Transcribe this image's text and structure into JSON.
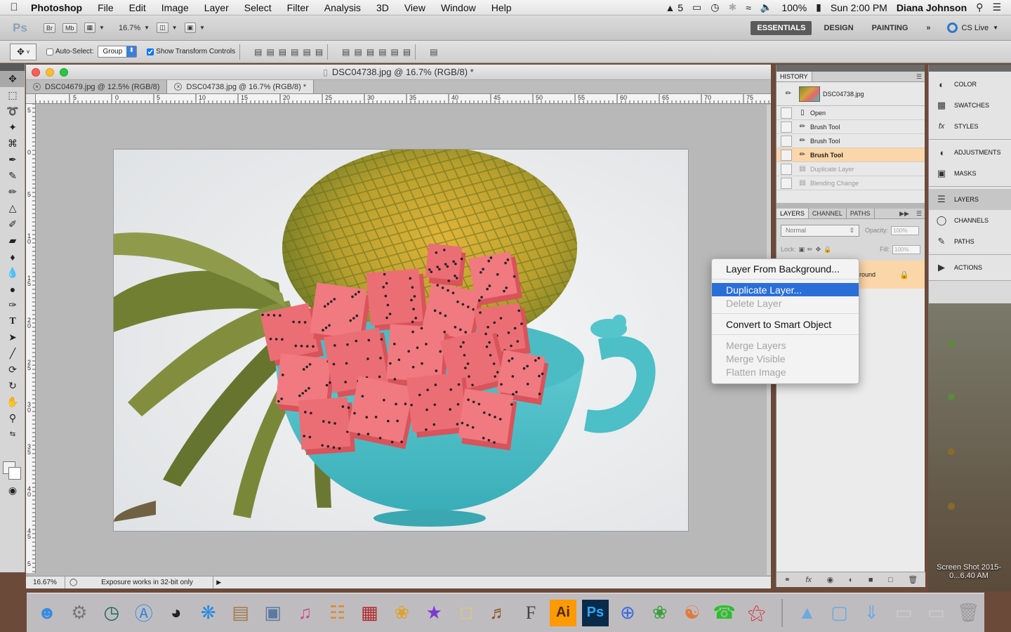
{
  "menubar": {
    "app_name": "Photoshop",
    "items": [
      "File",
      "Edit",
      "Image",
      "Layer",
      "Select",
      "Filter",
      "Analysis",
      "3D",
      "View",
      "Window",
      "Help"
    ],
    "status": {
      "adobe_badge": "5",
      "battery": "100%",
      "clock": "Sun 2:00 PM",
      "user": "Diana Johnson"
    }
  },
  "appbar": {
    "logo": "Ps",
    "bridge_label": "Br",
    "minibridge_label": "Mb",
    "zoom": "16.7%",
    "workspaces": [
      "ESSENTIALS",
      "DESIGN",
      "PAINTING"
    ],
    "cs_live": "CS Live"
  },
  "options": {
    "auto_select_label": "Auto-Select:",
    "auto_select_checked": false,
    "group_value": "Group",
    "show_transform_label": "Show Transform Controls",
    "show_transform_checked": true
  },
  "document": {
    "title": "DSC04738.jpg @ 16.7% (RGB/8) *",
    "tabs": [
      {
        "label": "DSC04679.jpg @ 12.5% (RGB/8)",
        "active": false
      },
      {
        "label": "DSC04738.jpg @ 16.7% (RGB/8) *",
        "active": true
      }
    ],
    "ruler_h": [
      "5",
      "0",
      "5",
      "10",
      "15",
      "20",
      "25",
      "30",
      "35",
      "40",
      "45",
      "50",
      "55",
      "60",
      "65",
      "70",
      "75"
    ],
    "ruler_v": [
      "5",
      "0",
      "5",
      "1\n0",
      "1\n5",
      "2\n0",
      "2\n5",
      "3\n0",
      "3\n5",
      "4\n0",
      "4\n5",
      "5"
    ],
    "status_zoom": "16.67%",
    "status_info": "Exposure works in 32-bit only"
  },
  "history": {
    "tab": "HISTORY",
    "snapshot": "DSC04738.jpg",
    "steps": [
      {
        "label": "Open",
        "state": "normal"
      },
      {
        "label": "Brush Tool",
        "state": "normal"
      },
      {
        "label": "Brush Tool",
        "state": "normal"
      },
      {
        "label": "Brush Tool",
        "state": "current"
      },
      {
        "label": "Duplicate Layer",
        "state": "dim"
      },
      {
        "label": "Blending Change",
        "state": "dim"
      }
    ]
  },
  "layers": {
    "tabs": [
      "LAYERS",
      "CHANNEL",
      "PATHS"
    ],
    "blend_mode": "Normal",
    "opacity_label": "Opacity:",
    "opacity_value": "100%",
    "lock_label": "Lock:",
    "fill_label": "Fill:",
    "fill_value": "100%",
    "layer_name_fragment": "round"
  },
  "icon_panel": {
    "groups": [
      [
        {
          "label": "COLOR",
          "icon": "color-wheel-icon"
        },
        {
          "label": "SWATCHES",
          "icon": "swatches-grid-icon"
        },
        {
          "label": "STYLES",
          "icon": "fx-icon"
        }
      ],
      [
        {
          "label": "ADJUSTMENTS",
          "icon": "adjustment-icon"
        },
        {
          "label": "MASKS",
          "icon": "mask-icon"
        }
      ],
      [
        {
          "label": "LAYERS",
          "icon": "layers-stack-icon"
        },
        {
          "label": "CHANNELS",
          "icon": "channels-icon"
        },
        {
          "label": "PATHS",
          "icon": "pen-path-icon"
        }
      ],
      [
        {
          "label": "ACTIONS",
          "icon": "play-icon"
        }
      ]
    ]
  },
  "context_menu": {
    "items": [
      {
        "label": "Layer From Background...",
        "state": "normal"
      },
      {
        "sep": true
      },
      {
        "label": "Duplicate Layer...",
        "state": "highlighted"
      },
      {
        "label": "Delete Layer",
        "state": "disabled"
      },
      {
        "sep": true
      },
      {
        "label": "Convert to Smart Object",
        "state": "normal"
      },
      {
        "sep": true
      },
      {
        "label": "Merge Layers",
        "state": "disabled"
      },
      {
        "label": "Merge Visible",
        "state": "disabled"
      },
      {
        "label": "Flatten Image",
        "state": "disabled"
      }
    ]
  },
  "desktop": {
    "screenshot_label": "Screen Shot 2015-0...6.40 AM"
  },
  "dock": {
    "icons": [
      "finder-icon",
      "system-preferences-icon",
      "time-machine-icon",
      "app-store-icon",
      "dashboard-icon",
      "safari-icon",
      "contacts-icon",
      "preview-icon",
      "itunes-icon",
      "ibooks-icon",
      "photo-booth-icon",
      "photos-icon",
      "imovie-icon",
      "stickies-icon",
      "garageband-icon",
      "fontbook-icon",
      "illustrator-icon",
      "photoshop-icon",
      "wunderlist-icon",
      "sketchbook-icon",
      "popclip-icon",
      "facetime-icon",
      "acrobat-icon",
      "applications-folder-icon",
      "documents-folder-icon",
      "downloads-folder-icon",
      "screenshot-file-icon",
      "screenshot-file-icon-2",
      "trash-icon"
    ],
    "labels": {
      "illustrator-icon": "Ai",
      "photoshop-icon": "Ps",
      "fontbook-icon": "F"
    }
  },
  "colors": {
    "highlight_blue": "#2a6ed8",
    "history_current": "#fbd6a8",
    "cs_live_blue": "#2c78c8"
  }
}
